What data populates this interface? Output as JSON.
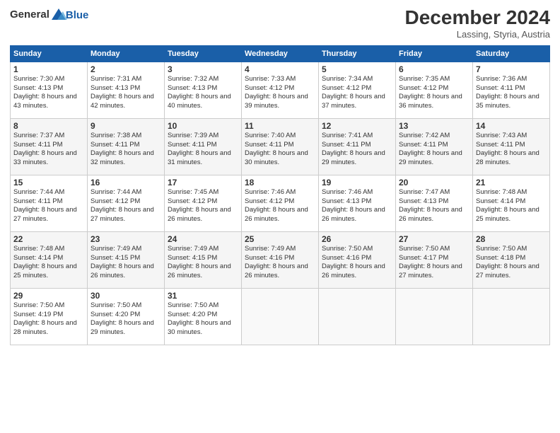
{
  "header": {
    "logo_line1": "General",
    "logo_line2": "Blue",
    "month": "December 2024",
    "location": "Lassing, Styria, Austria"
  },
  "days_of_week": [
    "Sunday",
    "Monday",
    "Tuesday",
    "Wednesday",
    "Thursday",
    "Friday",
    "Saturday"
  ],
  "weeks": [
    [
      {
        "day": "1",
        "sunrise": "7:30 AM",
        "sunset": "4:13 PM",
        "daylight": "8 hours and 43 minutes."
      },
      {
        "day": "2",
        "sunrise": "7:31 AM",
        "sunset": "4:13 PM",
        "daylight": "8 hours and 42 minutes."
      },
      {
        "day": "3",
        "sunrise": "7:32 AM",
        "sunset": "4:13 PM",
        "daylight": "8 hours and 40 minutes."
      },
      {
        "day": "4",
        "sunrise": "7:33 AM",
        "sunset": "4:12 PM",
        "daylight": "8 hours and 39 minutes."
      },
      {
        "day": "5",
        "sunrise": "7:34 AM",
        "sunset": "4:12 PM",
        "daylight": "8 hours and 37 minutes."
      },
      {
        "day": "6",
        "sunrise": "7:35 AM",
        "sunset": "4:12 PM",
        "daylight": "8 hours and 36 minutes."
      },
      {
        "day": "7",
        "sunrise": "7:36 AM",
        "sunset": "4:11 PM",
        "daylight": "8 hours and 35 minutes."
      }
    ],
    [
      {
        "day": "8",
        "sunrise": "7:37 AM",
        "sunset": "4:11 PM",
        "daylight": "8 hours and 33 minutes."
      },
      {
        "day": "9",
        "sunrise": "7:38 AM",
        "sunset": "4:11 PM",
        "daylight": "8 hours and 32 minutes."
      },
      {
        "day": "10",
        "sunrise": "7:39 AM",
        "sunset": "4:11 PM",
        "daylight": "8 hours and 31 minutes."
      },
      {
        "day": "11",
        "sunrise": "7:40 AM",
        "sunset": "4:11 PM",
        "daylight": "8 hours and 30 minutes."
      },
      {
        "day": "12",
        "sunrise": "7:41 AM",
        "sunset": "4:11 PM",
        "daylight": "8 hours and 29 minutes."
      },
      {
        "day": "13",
        "sunrise": "7:42 AM",
        "sunset": "4:11 PM",
        "daylight": "8 hours and 29 minutes."
      },
      {
        "day": "14",
        "sunrise": "7:43 AM",
        "sunset": "4:11 PM",
        "daylight": "8 hours and 28 minutes."
      }
    ],
    [
      {
        "day": "15",
        "sunrise": "7:44 AM",
        "sunset": "4:11 PM",
        "daylight": "8 hours and 27 minutes."
      },
      {
        "day": "16",
        "sunrise": "7:44 AM",
        "sunset": "4:12 PM",
        "daylight": "8 hours and 27 minutes."
      },
      {
        "day": "17",
        "sunrise": "7:45 AM",
        "sunset": "4:12 PM",
        "daylight": "8 hours and 26 minutes."
      },
      {
        "day": "18",
        "sunrise": "7:46 AM",
        "sunset": "4:12 PM",
        "daylight": "8 hours and 26 minutes."
      },
      {
        "day": "19",
        "sunrise": "7:46 AM",
        "sunset": "4:13 PM",
        "daylight": "8 hours and 26 minutes."
      },
      {
        "day": "20",
        "sunrise": "7:47 AM",
        "sunset": "4:13 PM",
        "daylight": "8 hours and 26 minutes."
      },
      {
        "day": "21",
        "sunrise": "7:48 AM",
        "sunset": "4:14 PM",
        "daylight": "8 hours and 25 minutes."
      }
    ],
    [
      {
        "day": "22",
        "sunrise": "7:48 AM",
        "sunset": "4:14 PM",
        "daylight": "8 hours and 25 minutes."
      },
      {
        "day": "23",
        "sunrise": "7:49 AM",
        "sunset": "4:15 PM",
        "daylight": "8 hours and 26 minutes."
      },
      {
        "day": "24",
        "sunrise": "7:49 AM",
        "sunset": "4:15 PM",
        "daylight": "8 hours and 26 minutes."
      },
      {
        "day": "25",
        "sunrise": "7:49 AM",
        "sunset": "4:16 PM",
        "daylight": "8 hours and 26 minutes."
      },
      {
        "day": "26",
        "sunrise": "7:50 AM",
        "sunset": "4:16 PM",
        "daylight": "8 hours and 26 minutes."
      },
      {
        "day": "27",
        "sunrise": "7:50 AM",
        "sunset": "4:17 PM",
        "daylight": "8 hours and 27 minutes."
      },
      {
        "day": "28",
        "sunrise": "7:50 AM",
        "sunset": "4:18 PM",
        "daylight": "8 hours and 27 minutes."
      }
    ],
    [
      {
        "day": "29",
        "sunrise": "7:50 AM",
        "sunset": "4:19 PM",
        "daylight": "8 hours and 28 minutes."
      },
      {
        "day": "30",
        "sunrise": "7:50 AM",
        "sunset": "4:20 PM",
        "daylight": "8 hours and 29 minutes."
      },
      {
        "day": "31",
        "sunrise": "7:50 AM",
        "sunset": "4:20 PM",
        "daylight": "8 hours and 30 minutes."
      },
      null,
      null,
      null,
      null
    ]
  ]
}
